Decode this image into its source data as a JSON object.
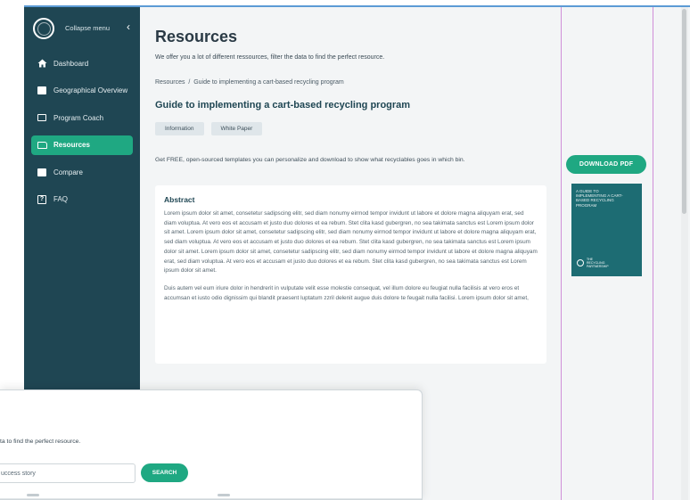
{
  "sidebar": {
    "collapse_label": "Collapse menu",
    "collapse_icon": "chevron-left",
    "items": [
      {
        "label": "Dashboard",
        "icon": "home-icon"
      },
      {
        "label": "Geographical Overview",
        "icon": "map-icon"
      },
      {
        "label": "Program Coach",
        "icon": "coach-icon"
      },
      {
        "label": "Resources",
        "icon": "folder-icon",
        "active": true
      },
      {
        "label": "Compare",
        "icon": "compare-icon"
      },
      {
        "label": "FAQ",
        "icon": "faq-icon"
      }
    ]
  },
  "main": {
    "title": "Resources",
    "subtitle": "We offer you a lot of different ressources, filter the data to find the perfect resource.",
    "breadcrumb": {
      "root": "Resources",
      "separator": "/",
      "current": "Guide to implementing a cart-based recycling program"
    },
    "doc_title": "Guide to implementing a cart-based recycling program",
    "tags": [
      "Information",
      "White Paper"
    ],
    "description": "Get FREE, open-sourced templates you can personalize and download to show what recyclables goes in which bin.",
    "abstract": {
      "heading": "Abstract",
      "p1": "Lorem ipsum dolor sit amet, consetetur sadipscing elitr, sed diam nonumy eirmod tempor invidunt ut labore et dolore magna aliquyam erat, sed diam voluptua. At vero eos et accusam et justo duo dolores et ea rebum. Stet clita kasd gubergren, no sea takimata sanctus est Lorem ipsum dolor sit amet. Lorem ipsum dolor sit amet, consetetur sadipscing elitr, sed diam nonumy eirmod tempor invidunt ut labore et dolore magna aliquyam erat, sed diam voluptua. At vero eos et accusam et justo duo dolores et ea rebum. Stet clita kasd gubergren, no sea takimata sanctus est Lorem ipsum dolor sit amet. Lorem ipsum dolor sit amet, consetetur sadipscing elitr, sed diam nonumy eirmod tempor invidunt ut labore et dolore magna aliquyam erat, sed diam voluptua. At vero eos et accusam et justo duo dolores et ea rebum. Stet clita kasd gubergren, no sea takimata sanctus est Lorem ipsum dolor sit amet.",
      "p2": "Duis autem vel eum iriure dolor in hendrerit in vulputate velit esse molestie consequat, vel illum dolore eu feugiat nulla facilisis at vero eros et accumsan et iusto odio dignissim qui blandit praesent luptatum zzril delenit augue duis dolore te feugait nulla facilisi. Lorem ipsum dolor sit amet,"
    },
    "download_label": "DOWNLOAD PDF",
    "cover": {
      "title": "A GUIDE TO IMPLEMENTING A CART-BASED RECYCLING PROGRAM",
      "logo_text": "THE RECYCLING PARTNERSHIP"
    }
  },
  "overlay": {
    "subtitle_fragment": "ta to find the perfect resource.",
    "search_value": "uccess story",
    "search_button": "SEARCH"
  },
  "colors": {
    "sidebar_bg": "#1f4653",
    "accent": "#1fa882",
    "cover_bg": "#1d6c73",
    "guide_line": "#d08fd8"
  }
}
